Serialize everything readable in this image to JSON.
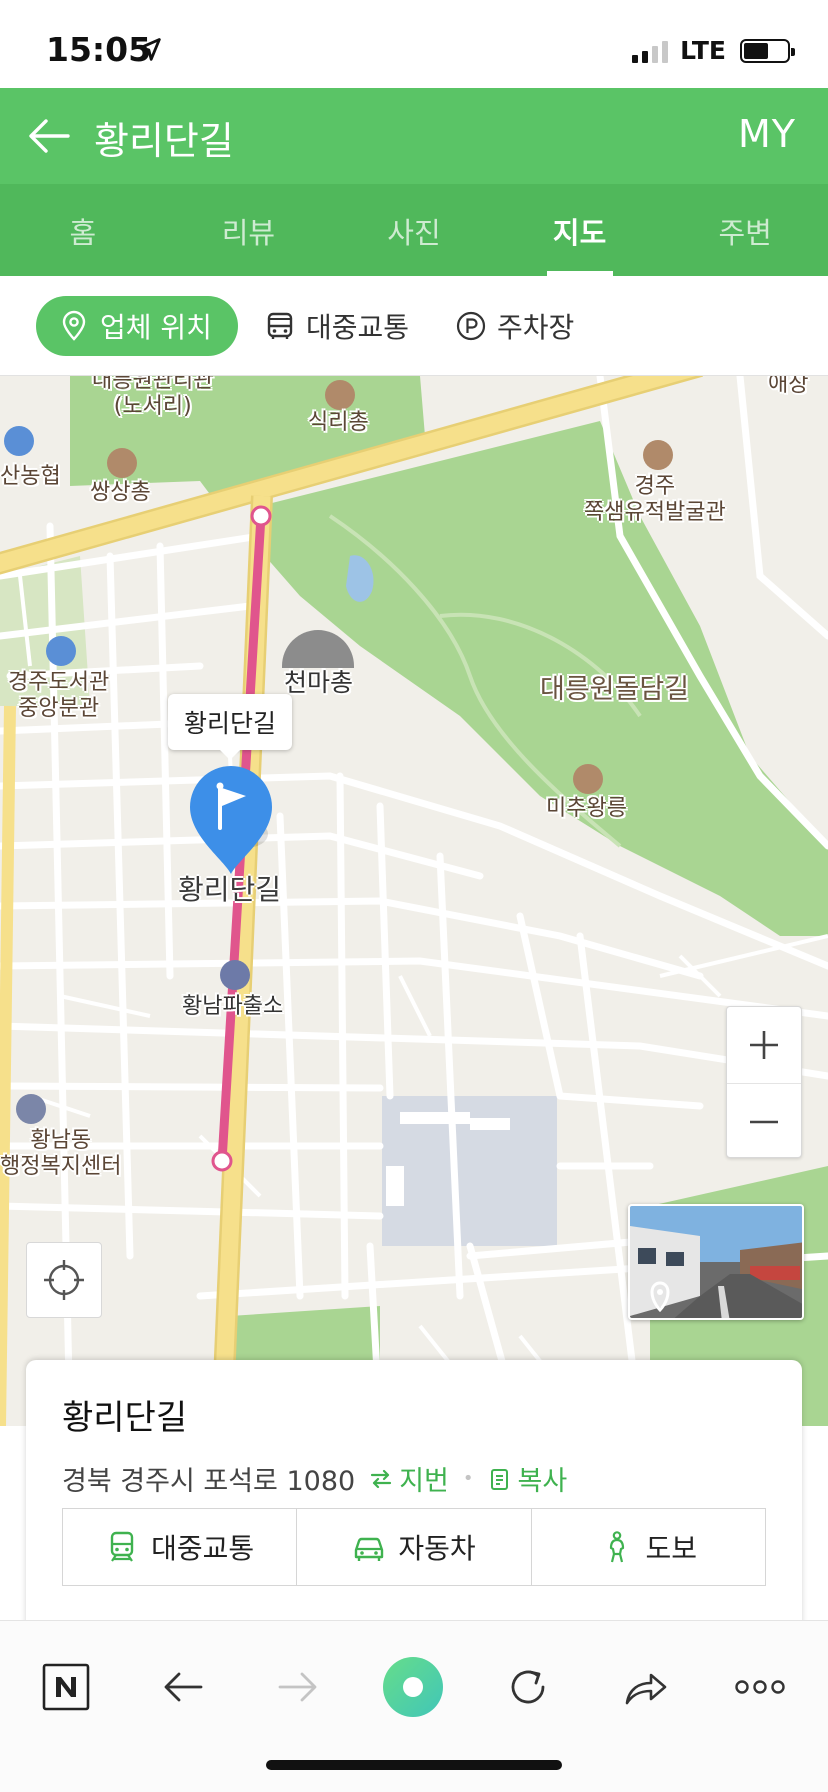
{
  "status": {
    "time": "15:05",
    "network": "LTE",
    "battery_level": 0.58
  },
  "header": {
    "title": "황리단길",
    "my_label": "MY"
  },
  "tabs": [
    {
      "label": "홈",
      "active": false
    },
    {
      "label": "리뷰",
      "active": false
    },
    {
      "label": "사진",
      "active": false
    },
    {
      "label": "지도",
      "active": true
    },
    {
      "label": "주변",
      "active": false
    }
  ],
  "chips": [
    {
      "label": "업체 위치",
      "icon": "location-pin-icon",
      "active": true
    },
    {
      "label": "대중교통",
      "icon": "bus-icon",
      "active": false
    },
    {
      "label": "주차장",
      "icon": "parking-icon",
      "active": false
    }
  ],
  "map": {
    "callout": "황리단길",
    "pin_label": "황리단길",
    "pois": {
      "daereungwon_top": "대릉원관리관",
      "noseori": "(노서리)",
      "sikricheong": "식리총",
      "nonghyup": "산농협",
      "ssangsangchong": "쌍상총",
      "jjoksaem_1": "경주",
      "jjoksaem_2": "쪽샘유적발굴관",
      "library_1": "경주도서관",
      "library_2": "중앙분관",
      "cheonmachong": "천마총",
      "daereungwon_dolmdam": "대릉원돌담길",
      "michuwang": "미추왕릉",
      "police": "황남파출소",
      "hwangnam_1": "황남동",
      "hwangnam_2": "행정복지센터",
      "top_right": "애장"
    },
    "colors": {
      "park": "#a9d592",
      "major_road": "#f6e08b",
      "route": "#e0558d",
      "pin": "#3d8fe8",
      "water": "#9dc3e6",
      "block": "#d5dae3"
    }
  },
  "card": {
    "title": "황리단길",
    "address": "경북 경주시 포석로 1080",
    "jibeon_label": "지번",
    "copy_label": "복사",
    "directions": [
      {
        "label": "대중교통",
        "icon": "train-icon"
      },
      {
        "label": "자동차",
        "icon": "car-icon"
      },
      {
        "label": "도보",
        "icon": "walk-icon"
      }
    ]
  },
  "browser_bar": {
    "buttons": [
      "naver-home-icon",
      "back-arrow-icon",
      "forward-arrow-icon",
      "green-dot-icon",
      "refresh-icon",
      "share-icon",
      "more-icon"
    ]
  },
  "accent_color": "#5ac466"
}
